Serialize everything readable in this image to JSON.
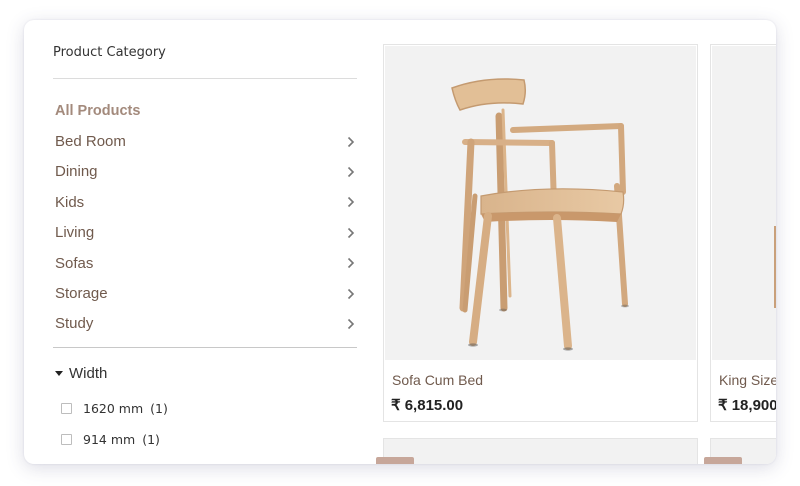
{
  "sidebar": {
    "title": "Product Category",
    "categories": [
      {
        "label": "All Products",
        "active": true
      },
      {
        "label": "Bed Room"
      },
      {
        "label": "Dining"
      },
      {
        "label": "Kids"
      },
      {
        "label": "Living"
      },
      {
        "label": "Sofas"
      },
      {
        "label": "Storage"
      },
      {
        "label": "Study"
      }
    ],
    "width_filter": {
      "label": "Width",
      "options": [
        {
          "value": "1620 mm",
          "count": "(1)"
        },
        {
          "value": "914 mm",
          "count": "(1)"
        }
      ]
    }
  },
  "products": [
    {
      "name": "Sofa Cum Bed",
      "price": "₹ 6,815.00",
      "image": "wooden-chair"
    },
    {
      "name": "King Size",
      "price": "₹ 18,900",
      "image": "wooden-bed"
    }
  ],
  "colors": {
    "accent": "#705a4d",
    "accent_light": "#a38a7c",
    "image_bg": "#f2f2f2"
  }
}
